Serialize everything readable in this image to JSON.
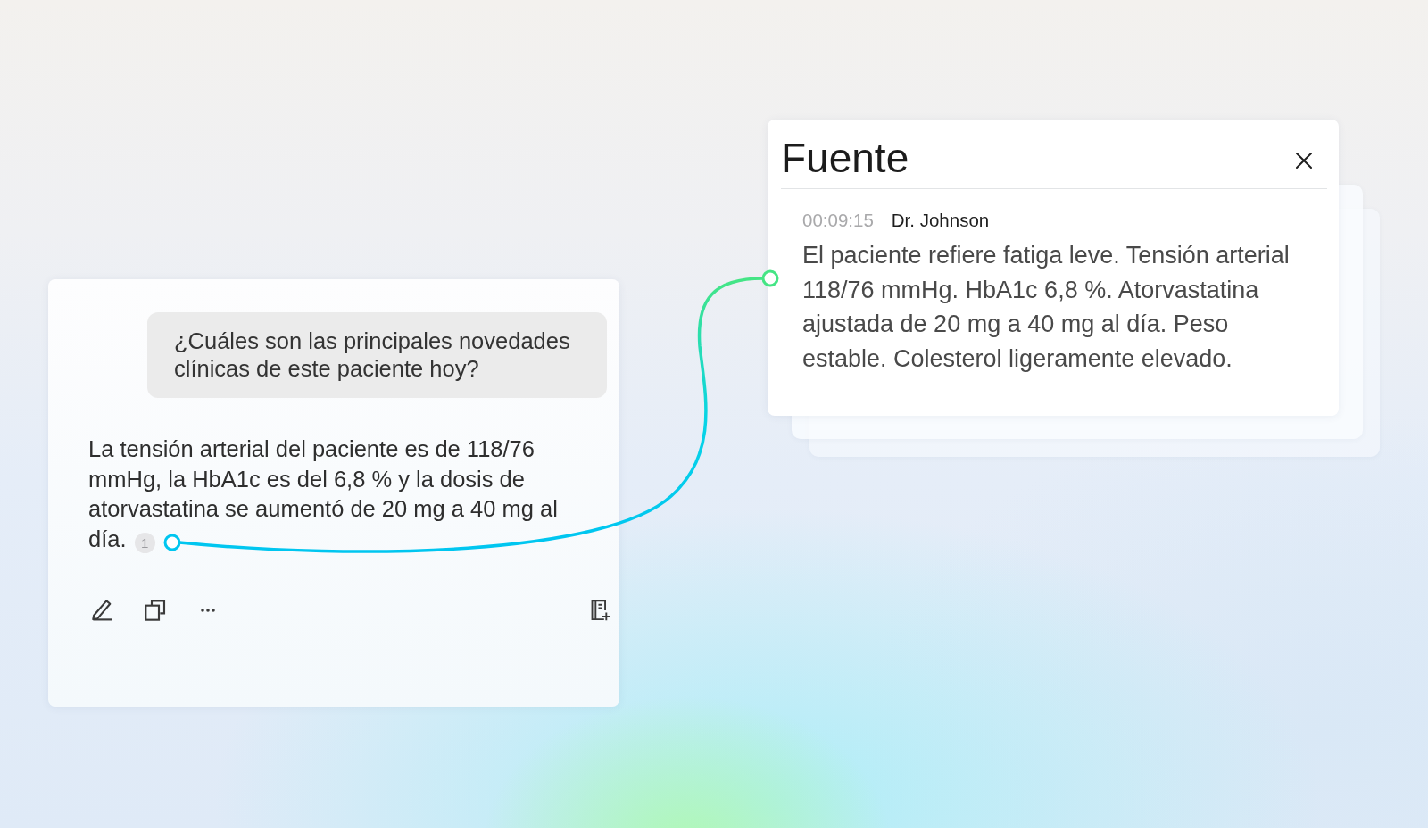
{
  "chat_card": {
    "question": "¿Cuáles son las principales novedades clínicas de este paciente hoy?",
    "answer": "La tensión arterial del paciente es de 118/76 mmHg, la HbA1c es del 6,8 % y la dosis de atorvastatina se aumentó de 20 mg a 40 mg al día.",
    "citation": "1",
    "actions": [
      {
        "kind": "edit"
      },
      {
        "kind": "copy"
      },
      {
        "kind": "more"
      }
    ],
    "side_actions": [
      {
        "kind": "add-to-notes"
      }
    ]
  },
  "source_panel": {
    "title": "Fuente",
    "entry": {
      "timestamp": "00:09:15",
      "speaker": "Dr. Johnson",
      "text": "El paciente refiere fatiga leve. Tensión arterial 118/76 mmHg. HbA1c 6,8 %. Atorvastatina ajustada de 20 mg a 40 mg al día. Peso estable. Colesterol ligeramente elevado."
    }
  }
}
